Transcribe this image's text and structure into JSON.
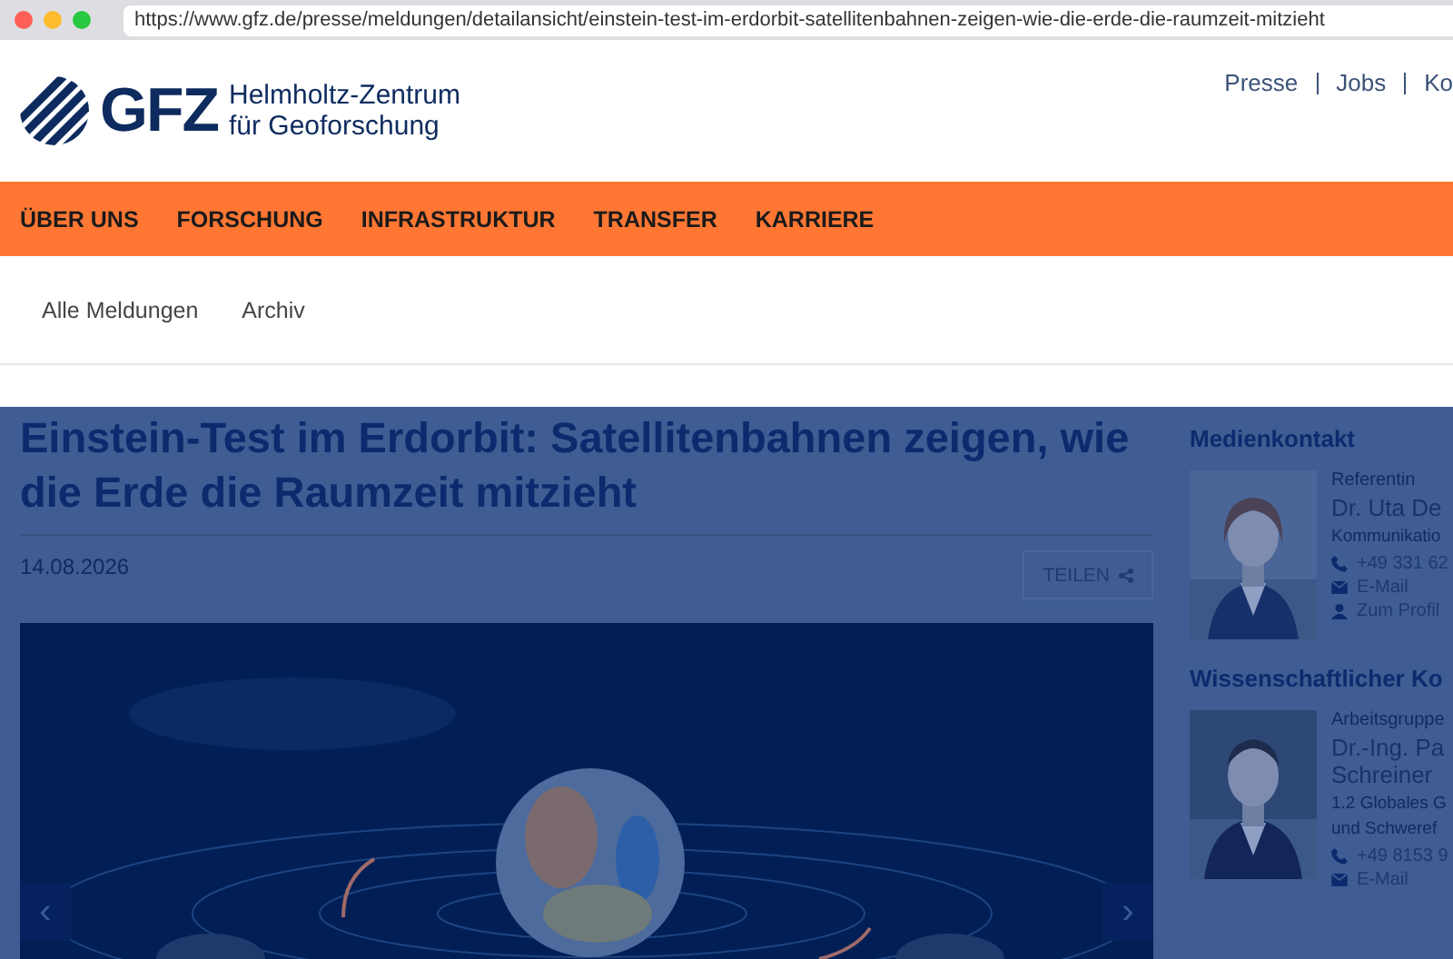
{
  "browser": {
    "url": "https://www.gfz.de/presse/meldungen/detailansicht/einstein-test-im-erdorbit-satellitenbahnen-zeigen-wie-die-erde-die-raumzeit-mitzieht"
  },
  "header": {
    "logo_text": "GFZ",
    "logo_line_1": "Helmholtz-Zentrum",
    "logo_line_2": "für Geoforschung",
    "links": [
      "Presse",
      "Jobs",
      "Ko"
    ]
  },
  "main_nav": [
    "ÜBER UNS",
    "FORSCHUNG",
    "INFRASTRUKTUR",
    "TRANSFER",
    "KARRIERE"
  ],
  "sub_nav": [
    "Alle Meldungen",
    "Archiv"
  ],
  "article": {
    "title": "Einstein-Test im Erdorbit: Satellitenbahnen zeigen, wie die Erde die Raumzeit mitzieht",
    "date": "14.08.2026",
    "share_label": "TEILEN",
    "carousel": {
      "prev": "‹",
      "next": "›"
    }
  },
  "sidebar": [
    {
      "heading": "Medienkontakt",
      "role": "Referentin",
      "name": "Dr. Uta De",
      "unit": "Kommunikatio",
      "contacts": [
        {
          "kind": "phone",
          "text": "+49 331 62"
        },
        {
          "kind": "mail",
          "text": "E-Mail"
        },
        {
          "kind": "profile",
          "text": "Zum Profil"
        }
      ]
    },
    {
      "heading": "Wissenschaftlicher Ko",
      "role": "Arbeitsgruppe",
      "name": "Dr.-Ing. Pa Schreiner",
      "unit": "1.2 Globales G und Schweref",
      "contacts": [
        {
          "kind": "phone",
          "text": "+49 8153 9"
        },
        {
          "kind": "mail",
          "text": "E-Mail"
        }
      ]
    }
  ]
}
